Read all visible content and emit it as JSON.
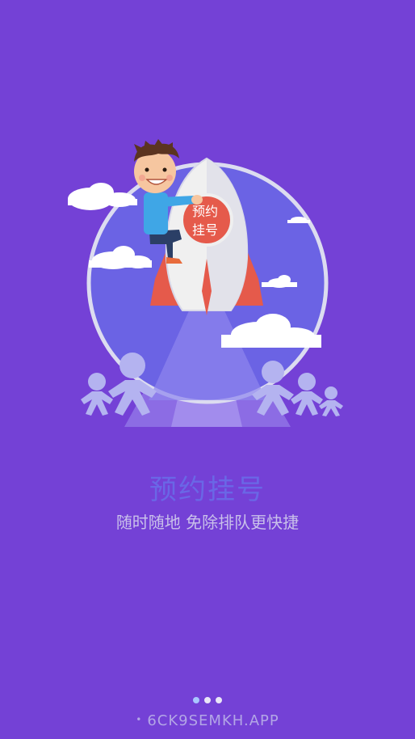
{
  "rocket_badge": {
    "line1": "预约",
    "line2": "挂号"
  },
  "title": "预约挂号",
  "subtitle": "随时随地 免除排队更快捷",
  "pager": {
    "total": 3,
    "active_index": 0
  },
  "footer": {
    "bullet": "•",
    "text": "6CK9SEMKH.APP"
  },
  "colors": {
    "background": "#7441d6",
    "title": "#6a67e6",
    "subtitle": "#c9c0ea",
    "circle_fill": "#6b63e4",
    "circle_ring": "#dcdcf0",
    "badge": "#e55a4b",
    "rocket_body": "#f0f0f0",
    "people": "#b4b3f0"
  },
  "icons": [
    "rocket-icon",
    "boy-character",
    "cloud-icon",
    "person-figure-icon"
  ]
}
